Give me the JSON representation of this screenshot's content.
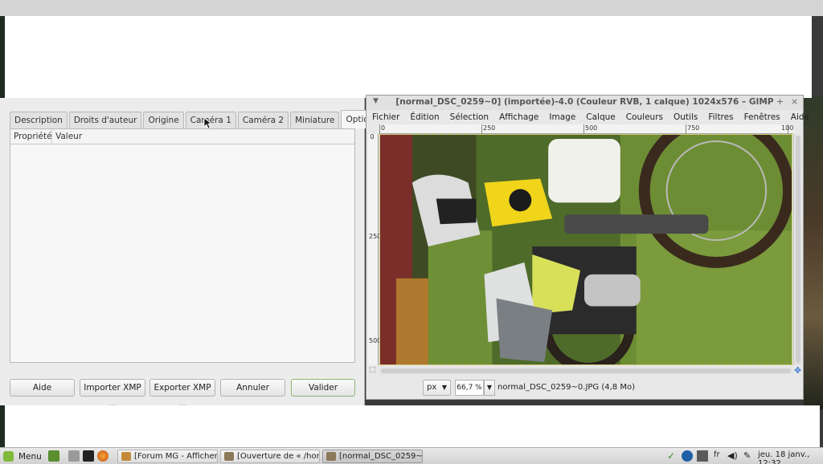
{
  "dialog": {
    "tabs": [
      {
        "label": "Description"
      },
      {
        "label": "Droits d'auteur"
      },
      {
        "label": "Origine"
      },
      {
        "label": "Caméra 1"
      },
      {
        "label": "Caméra 2"
      },
      {
        "label": "Miniature"
      },
      {
        "label": "Options avancées"
      }
    ],
    "active_tab": "Options avancées",
    "columns": {
      "property": "Propriété",
      "value": "Valeur"
    },
    "buttons": {
      "help": "Aide",
      "import_xmp": "Importer XMP ...",
      "export_xmp": "Exporter XMP ...",
      "cancel": "Annuler",
      "validate": "Valider"
    }
  },
  "gimp": {
    "title": "[normal_DSC_0259~0] (importée)-4.0 (Couleur RVB, 1 calque) 1024x576 – GIMP",
    "menu": [
      "Fichier",
      "Édition",
      "Sélection",
      "Affichage",
      "Image",
      "Calque",
      "Couleurs",
      "Outils",
      "Filtres",
      "Fenêtres",
      "Aide"
    ],
    "ruler_top": [
      "0",
      "250",
      "500",
      "750",
      "100"
    ],
    "ruler_left": [
      "0",
      "250",
      "500"
    ],
    "status": {
      "unit": "px",
      "zoom": "66,7 %",
      "file": "normal_DSC_0259~0.JPG (4,8 Mo)"
    }
  },
  "taskbar": {
    "menu_label": "Menu",
    "tasks": [
      {
        "label": "[Forum MG - Afficher..."
      },
      {
        "label": "[Ouverture de « /hom..."
      },
      {
        "label": "[normal_DSC_0259~0..."
      }
    ],
    "keyboard_layout": "fr",
    "clock": "jeu. 18 janv., 12:32"
  },
  "colors": {
    "accent_green": "#7fba3a",
    "dialog_bg": "#ececec",
    "selection_dash": "#d9d14a"
  },
  "icons": [
    "mint-menu-icon",
    "show-desktop-icon",
    "files-icon",
    "terminal-icon",
    "firefox-icon",
    "gimp-icon",
    "shield-check-icon",
    "hp-icon",
    "network-icon",
    "volume-icon",
    "pen-icon",
    "cursor-icon",
    "navigate-icon"
  ]
}
